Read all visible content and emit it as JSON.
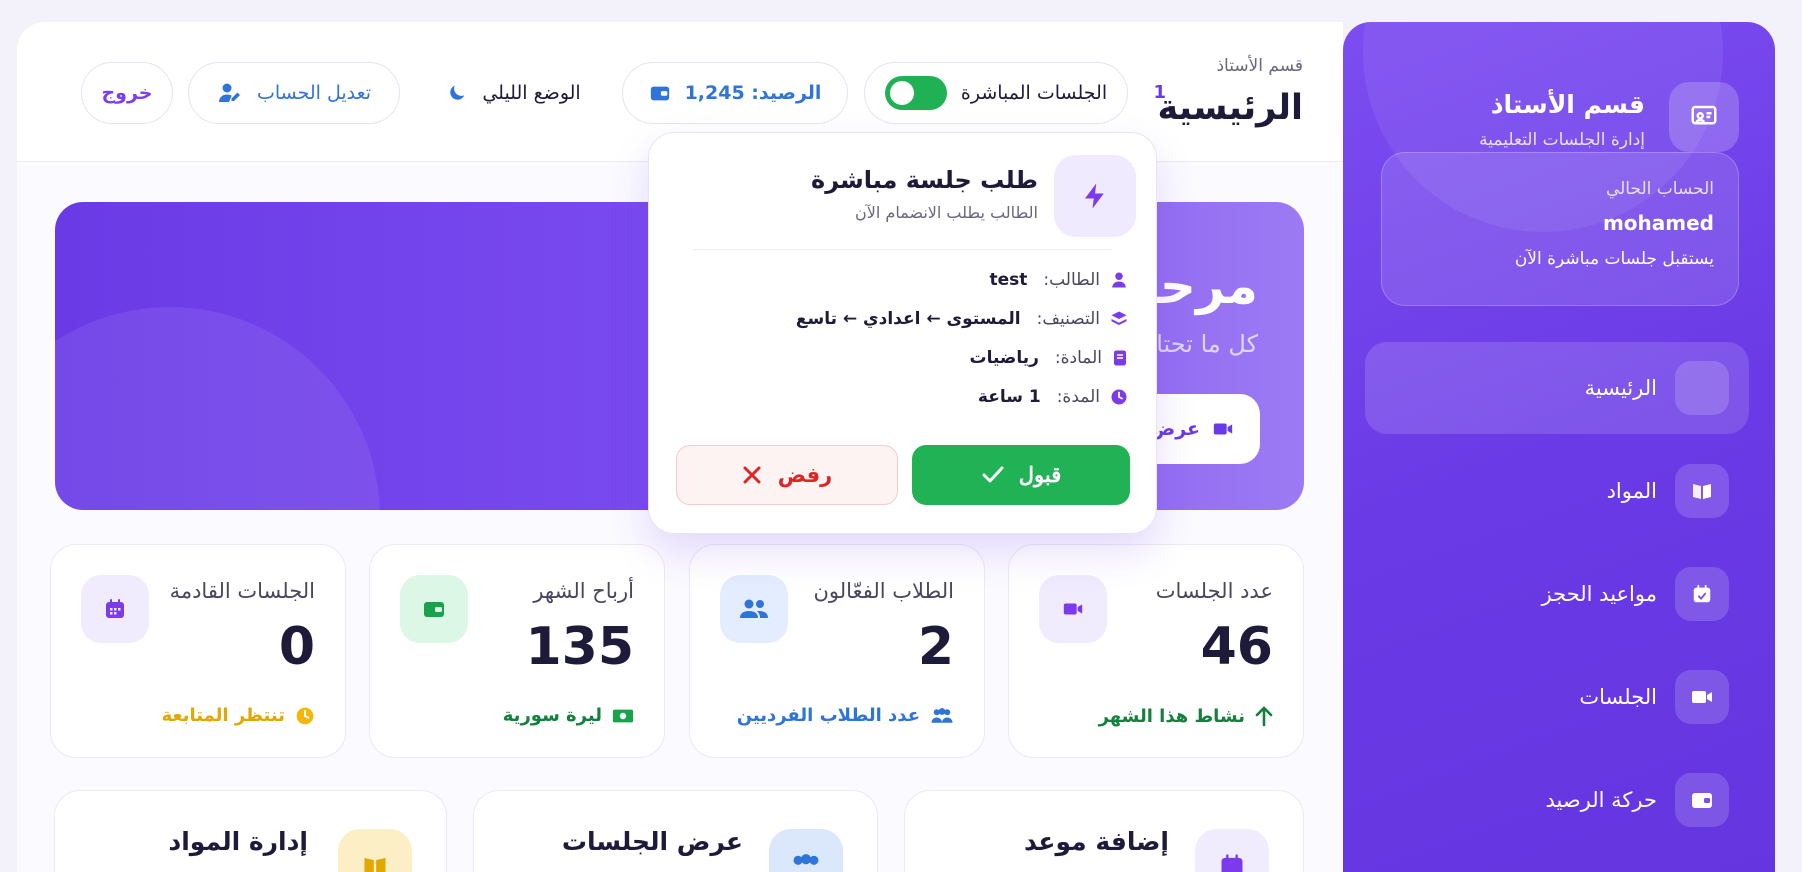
{
  "sidebar": {
    "title": "قسم الأستاذ",
    "subtitle": "إدارة الجلسات التعليمية",
    "account": {
      "label": "الحساب الحالي",
      "name": "mohamed",
      "status": "يستقبل جلسات مباشرة الآن"
    },
    "items": [
      {
        "label": "الرئيسية",
        "icon": "home-icon",
        "active": true
      },
      {
        "label": "المواد",
        "icon": "book-icon"
      },
      {
        "label": "مواعيد الحجز",
        "icon": "calendar-check-icon"
      },
      {
        "label": "الجلسات",
        "icon": "video-icon"
      },
      {
        "label": "حركة الرصيد",
        "icon": "wallet-icon"
      }
    ]
  },
  "header": {
    "breadcrumb": "قسم الأستاذ",
    "title": "الرئيسية",
    "notif_count": "1",
    "live_label": "الجلسات المباشرة",
    "balance_label": "الرصيد: 1,245",
    "dark_label": "الوضع الليلي",
    "edit_label": "تعديل الحساب",
    "logout_label": "خروج"
  },
  "banner": {
    "title": "مرحبًا",
    "subtitle": "كل ما تحتاجه في مكان واحد بشكل واضح وسريع.",
    "button_label": "عرض"
  },
  "stats": [
    {
      "label": "عدد الجلسات",
      "value": "46",
      "foot": "نشاط هذا الشهر",
      "color": "#15803d",
      "icon": "video-icon"
    },
    {
      "label": "الطلاب الفعّالون",
      "value": "2",
      "foot": "عدد الطلاب الفرديين",
      "color": "#2f74d8",
      "icon": "users-icon"
    },
    {
      "label": "أرباح الشهر",
      "value": "135",
      "foot": "ليرة سورية",
      "color": "#15803d",
      "icon": "wallet-icon"
    },
    {
      "label": "الجلسات القادمة",
      "value": "0",
      "foot": "تنتظر المتابعة",
      "color": "#e0a800",
      "icon": "calendar-icon"
    }
  ],
  "actions": [
    {
      "title": "إضافة موعد",
      "icon": "calendar-icon"
    },
    {
      "title": "عرض الجلسات",
      "icon": "users-icon"
    },
    {
      "title": "إدارة المواد",
      "icon": "book-icon"
    }
  ],
  "modal": {
    "title": "طلب جلسة مباشرة",
    "subtitle": "الطالب يطلب الانضمام الآن",
    "rows": [
      {
        "key": "الطالب:",
        "value": "test",
        "icon": "user-icon"
      },
      {
        "key": "التصنيف:",
        "value": "المستوى ← اعدادي ← تاسع",
        "icon": "layers-icon"
      },
      {
        "key": "المادة:",
        "value": "رياضيات",
        "icon": "book-icon"
      },
      {
        "key": "المدة:",
        "value": "1  ساعة",
        "icon": "clock-icon"
      }
    ],
    "accept_label": "قبول",
    "reject_label": "رفض"
  },
  "colors": {
    "primary": "#6a3ae6",
    "success": "#20b254",
    "danger": "#dc2626",
    "info": "#2f74d8",
    "warning": "#e0a800"
  }
}
